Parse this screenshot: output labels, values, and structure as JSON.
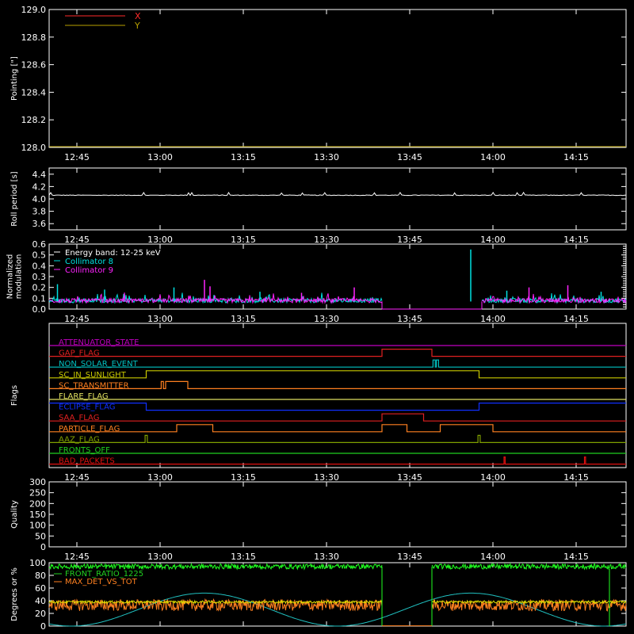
{
  "x_axis": {
    "range": [
      "12:40",
      "14:24"
    ],
    "tick_labels": [
      "12:45",
      "13:00",
      "13:15",
      "13:30",
      "13:45",
      "14:00",
      "14:15"
    ],
    "tick_minutes": [
      765,
      780,
      795,
      810,
      825,
      840,
      855
    ],
    "range_minutes": [
      760,
      864
    ]
  },
  "chart_data": [
    {
      "type": "line",
      "panel": "pointing",
      "ylabel": "Pointing [\"]",
      "ylim": [
        128.0,
        129.0
      ],
      "yticks": [
        "128.0",
        "128.2",
        "128.4",
        "128.6",
        "128.8",
        "129.0"
      ],
      "legend": [
        {
          "name": "X",
          "color": "#ff2a2a"
        },
        {
          "name": "Y",
          "color": "#b8a000"
        }
      ],
      "legend_placement": "top-left",
      "series": [
        {
          "name": "X",
          "color": "#ff2a2a",
          "y": [],
          "note_hidden": ""
        },
        {
          "name": "Y",
          "color": "#b8a000",
          "y": []
        }
      ]
    },
    {
      "type": "line",
      "panel": "roll",
      "ylabel": "Roll period [s]",
      "ylim": [
        3.5,
        4.5
      ],
      "yticks": [
        "3.6",
        "3.8",
        "4.0",
        "4.2",
        "4.4"
      ],
      "series": [
        {
          "color": "#ffffff",
          "baseline": 4.06
        }
      ]
    },
    {
      "type": "line",
      "panel": "modulation",
      "ylabel": "Normalized modulation",
      "ylim": [
        0.0,
        0.6
      ],
      "yticks": [
        "0.0",
        "0.1",
        "0.2",
        "0.3",
        "0.4",
        "0.5",
        "0.6"
      ],
      "legend": [
        {
          "name": "Energy band: 12-25 keV",
          "color": "#ffffff"
        },
        {
          "name": "Collimator 8",
          "color": "#00e0e0"
        },
        {
          "name": "Collimator 9",
          "color": "#ff22ff"
        }
      ],
      "legend_placement": "top-left",
      "gaps": [
        [
          820,
          838
        ]
      ],
      "baseline": 0.07,
      "spikes": [
        {
          "x": 836.0,
          "y": 0.55,
          "color": "#00e0e0"
        },
        {
          "x": 788.0,
          "y": 0.27,
          "color": "#ff22ff"
        },
        {
          "x": 761.5,
          "y": 0.23,
          "color": "#00e0e0"
        },
        {
          "x": 782.5,
          "y": 0.2,
          "color": "#00e0e0"
        },
        {
          "x": 789.0,
          "y": 0.21,
          "color": "#ff22ff"
        },
        {
          "x": 846.5,
          "y": 0.2,
          "color": "#ff22ff"
        },
        {
          "x": 853.5,
          "y": 0.22,
          "color": "#ff22ff"
        },
        {
          "x": 815.0,
          "y": 0.2,
          "color": "#ff22ff"
        },
        {
          "x": 770.0,
          "y": 0.18,
          "color": "#00e0e0"
        },
        {
          "x": 798.0,
          "y": 0.16,
          "color": "#00e0e0"
        },
        {
          "x": 805.5,
          "y": 0.15,
          "color": "#ff22ff"
        },
        {
          "x": 842.5,
          "y": 0.17,
          "color": "#00e0e0"
        },
        {
          "x": 859.5,
          "y": 0.16,
          "color": "#00e0e0"
        }
      ]
    },
    {
      "type": "line",
      "panel": "flags",
      "ylabel": "Flags",
      "flags": [
        {
          "name": "ATTENUATOR_STATE",
          "color": "#c000c0",
          "segments": []
        },
        {
          "name": "GAP_FLAG",
          "color": "#e02020",
          "segments": [
            [
              820,
              829
            ]
          ]
        },
        {
          "name": "NON_SOLAR_EVENT",
          "color": "#00c0c0",
          "segments": [
            [
              829.2,
              829.6
            ],
            [
              829.8,
              830.2
            ]
          ]
        },
        {
          "name": "SC_IN_SUNLIGHT",
          "color": "#c8c800",
          "segments": [
            [
              777.5,
              837.5
            ]
          ]
        },
        {
          "name": "SC_TRANSMITTER",
          "color": "#ff8020",
          "segments": [
            [
              780.2,
              780.6
            ],
            [
              781.0,
              785.0
            ]
          ]
        },
        {
          "name": "FLARE_FLAG",
          "color": "#e0e060",
          "segments": []
        },
        {
          "name": "ECLIPSE_FLAG",
          "color": "#1030ff",
          "segments": [
            [
              760,
              777.5
            ],
            [
              837.5,
              864
            ]
          ],
          "low_level": 1
        },
        {
          "name": "SAA_FLAG",
          "color": "#e02020",
          "segments": [
            [
              820,
              827.5
            ]
          ]
        },
        {
          "name": "PARTICLE_FLAG",
          "color": "#ff8020",
          "segments": [
            [
              783,
              789.5
            ],
            [
              820,
              824.5
            ],
            [
              830.5,
              840
            ]
          ]
        },
        {
          "name": "AAZ_FLAG",
          "color": "#80a000",
          "segments": [
            [
              777.3,
              777.7
            ],
            [
              837.3,
              837.7
            ]
          ]
        },
        {
          "name": "FRONTS_OFF",
          "color": "#20d020",
          "segments": []
        },
        {
          "name": "BAD_PACKETS",
          "color": "#e01010",
          "segments": [
            [
              842.0,
              842.2
            ],
            [
              856.5,
              856.7
            ]
          ]
        }
      ]
    },
    {
      "type": "line",
      "panel": "quality",
      "ylabel": "Quality",
      "ylim": [
        0,
        300
      ],
      "yticks": [
        "0",
        "50",
        "100",
        "150",
        "200",
        "250",
        "300"
      ],
      "series": []
    },
    {
      "type": "line",
      "panel": "degrees",
      "ylabel": "Degrees or %",
      "ylim": [
        0,
        100
      ],
      "yticks": [
        "0",
        "20",
        "40",
        "60",
        "80",
        "100"
      ],
      "legend": [
        {
          "name": "FRONT_RATIO_1225",
          "color": "#20d020"
        },
        {
          "name": "MAX_DET_VS_TOT",
          "color": "#ff8020"
        }
      ],
      "legend_placement": "top-left",
      "gaps": [
        [
          820,
          829
        ]
      ],
      "series": [
        {
          "name": "green",
          "color": "#20ff20",
          "mean": 94
        },
        {
          "name": "orange",
          "color": "#ff8020",
          "mean": 33
        },
        {
          "name": "yellow",
          "color": "#e0e000",
          "mean": 38
        },
        {
          "name": "cyan",
          "color": "#20c0c0",
          "period_minutes": 48,
          "min": 0,
          "max": 52
        }
      ]
    }
  ]
}
